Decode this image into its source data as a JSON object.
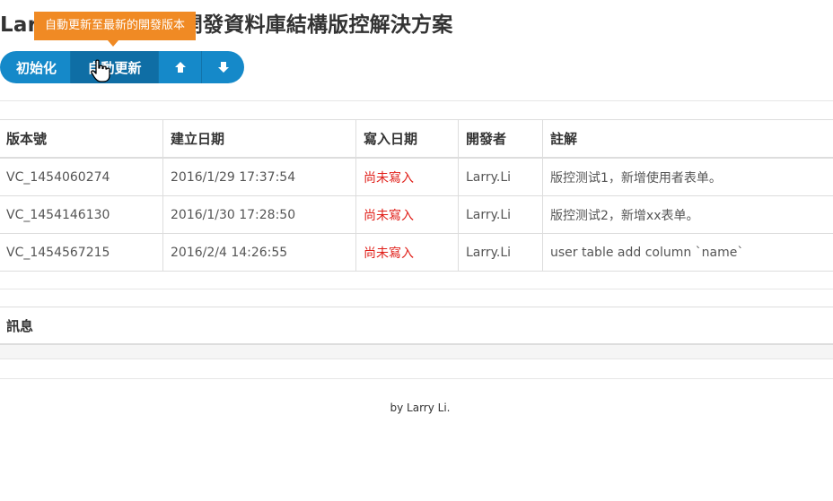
{
  "header": {
    "title": "Larry DBVC 多人開發資料庫結構版控解決方案"
  },
  "tooltip": {
    "text": "自動更新至最新的開發版本"
  },
  "toolbar": {
    "init_label": "初始化",
    "auto_update_label": "自動更新",
    "up_icon": "arrow-up-icon",
    "down_icon": "arrow-down-icon"
  },
  "table": {
    "columns": [
      "版本號",
      "建立日期",
      "寫入日期",
      "開發者",
      "註解"
    ],
    "rows": [
      [
        "VC_1454060274",
        "2016/1/29 17:37:54",
        "尚未寫入",
        "Larry.Li",
        "版控测试1，新增使用者表单。"
      ],
      [
        "VC_1454146130",
        "2016/1/30 17:28:50",
        "尚未寫入",
        "Larry.Li",
        "版控测试2，新增xx表单。"
      ],
      [
        "VC_1454567215",
        "2016/2/4 14:26:55",
        "尚未寫入",
        "Larry.Li",
        "user table add column `name`"
      ]
    ]
  },
  "messages": {
    "title": "訊息"
  },
  "footer": {
    "text": "by Larry Li."
  },
  "colors": {
    "button": "#1589c9",
    "button_active": "#0f6ea5",
    "tooltip": "#f08a24",
    "status": "#e0201a"
  }
}
